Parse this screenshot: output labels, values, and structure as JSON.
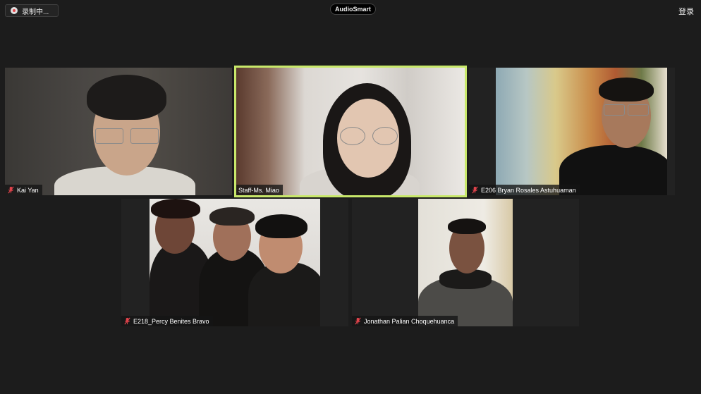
{
  "top_bar": {
    "recording_label": "录制中...",
    "app_badge": "AudioSmart",
    "login_label": "登录"
  },
  "participants": [
    {
      "name": "Kai Yan",
      "muted": true,
      "active_speaker": false
    },
    {
      "name": "Staff-Ms. Miao",
      "muted": false,
      "active_speaker": true
    },
    {
      "name": "E206 Bryan Rosales Astuhuaman",
      "muted": true,
      "active_speaker": false
    },
    {
      "name": "E218_Percy Benites Bravo",
      "muted": true,
      "active_speaker": false
    },
    {
      "name": "Jonathan Palian Choquehuanca",
      "muted": true,
      "active_speaker": false
    }
  ],
  "colors": {
    "background": "#1c1c1c",
    "active_speaker_border": "#c8e86a",
    "mute_icon": "#e0434b"
  },
  "icons": {
    "recording": "record-icon",
    "muted": "mic-muted-icon"
  }
}
